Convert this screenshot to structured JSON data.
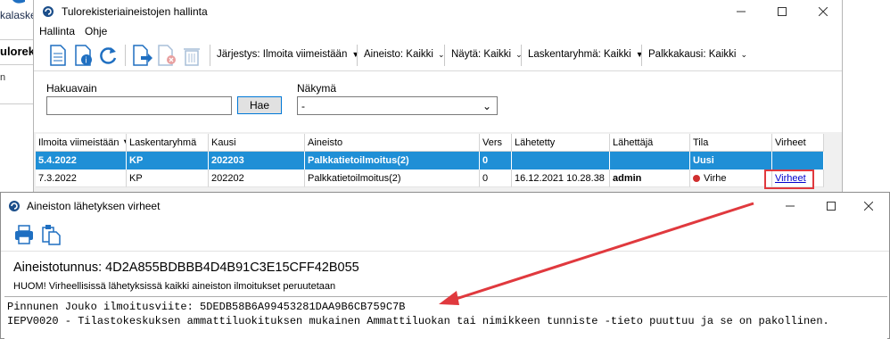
{
  "background_app": {
    "text1": "kalaske",
    "text2": "ulorekis",
    "text3": "n"
  },
  "main_window": {
    "title": "Tulorekisteriaineistojen hallinta",
    "menu": [
      "Hallinta",
      "Ohje"
    ],
    "toolbar": {
      "sort": "Järjestys: Ilmoita viimeistään",
      "aineisto": "Aineisto: Kaikki",
      "nayta": "Näytä: Kaikki",
      "laskentaryhma": "Laskentaryhmä: Kaikki",
      "palkkakausi": "Palkkakausi: Kaikki"
    },
    "search": {
      "label": "Hakuavain",
      "value": "",
      "button": "Hae",
      "view_label": "Näkymä",
      "view_value": "-"
    },
    "grid": {
      "columns": [
        "Ilmoita viimeistään ▼",
        "Laskentaryhmä",
        "Kausi",
        "Aineisto",
        "Vers",
        "Lähetetty",
        "Lähettäjä",
        "Tila",
        "Virheet"
      ],
      "rows": [
        [
          "5.4.2022",
          "KP",
          "202203",
          "Palkkatietoilmoitus(2)",
          "0",
          "",
          "",
          "Uusi",
          ""
        ],
        [
          "7.3.2022",
          "KP",
          "202202",
          "Palkkatietoilmoitus(2)",
          "0",
          "16.12.2021 10.28.38",
          "admin",
          "Virhe",
          "Virheet"
        ]
      ]
    }
  },
  "errors_window": {
    "title": "Aineiston lähetyksen virheet",
    "heading": "Aineistotunnus: 4D2A855BDBBB4D4B91C3E15CFF42B055",
    "notice": "HUOM! Virheellisissä lähetyksissä kaikki aineiston ilmoitukset peruutetaan",
    "lines": [
      "Pinnunen Jouko ilmoitusviite: 5DEDB58B6A99453281DAA9B6CB759C7B",
      "IEPV0020 - Tilastokeskuksen ammattiluokituksen mukainen Ammattiluokan tai nimikkeen tunniste -tieto puuttuu ja se on pakollinen."
    ]
  },
  "colors": {
    "selection": "#1f8fd6",
    "annotation": "#e0393e"
  }
}
